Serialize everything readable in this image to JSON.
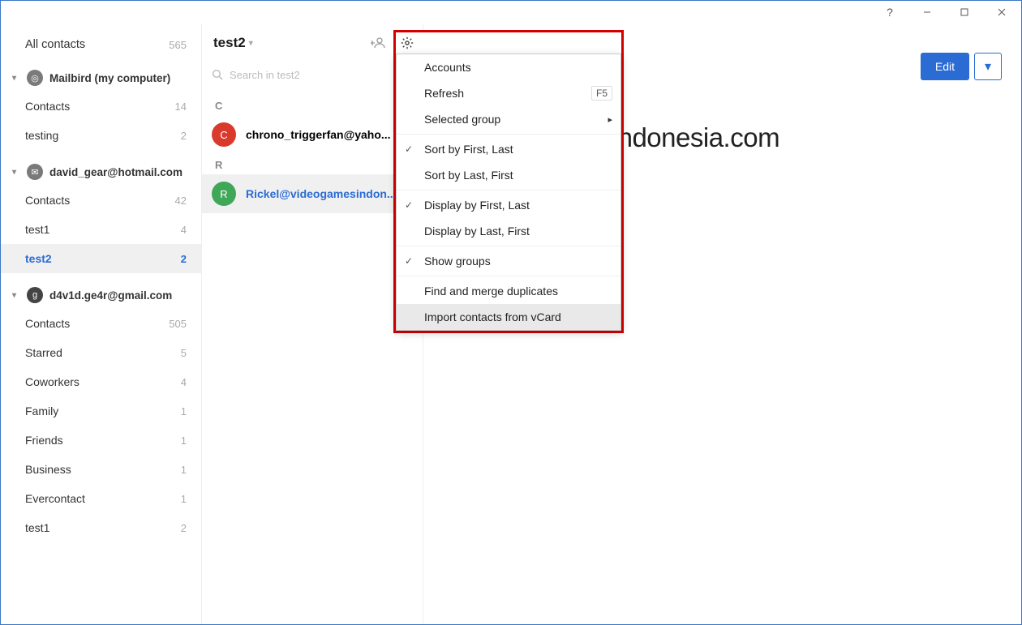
{
  "titlebar": {
    "help": "?",
    "min": "min",
    "max": "max",
    "close": "close"
  },
  "sidebar": {
    "all_label": "All contacts",
    "all_count": "565",
    "accounts": [
      {
        "name": "Mailbird (my computer)",
        "badge_bg": "#7a7a7a",
        "badge_fg": "#fff",
        "badge_type": "mailbird",
        "groups": [
          {
            "label": "Contacts",
            "count": "14",
            "selected": false
          },
          {
            "label": "testing",
            "count": "2",
            "selected": false
          }
        ]
      },
      {
        "name": "david_gear@hotmail.com",
        "badge_bg": "#7a7a7a",
        "badge_fg": "#fff",
        "badge_type": "outlook",
        "groups": [
          {
            "label": "Contacts",
            "count": "42",
            "selected": false
          },
          {
            "label": "test1",
            "count": "4",
            "selected": false
          },
          {
            "label": "test2",
            "count": "2",
            "selected": true
          }
        ]
      },
      {
        "name": "d4v1d.ge4r@gmail.com",
        "badge_bg": "#444",
        "badge_fg": "#fff",
        "badge_type": "google",
        "groups": [
          {
            "label": "Contacts",
            "count": "505",
            "selected": false
          },
          {
            "label": "Starred",
            "count": "5",
            "selected": false
          },
          {
            "label": "Coworkers",
            "count": "4",
            "selected": false
          },
          {
            "label": "Family",
            "count": "1",
            "selected": false
          },
          {
            "label": "Friends",
            "count": "1",
            "selected": false
          },
          {
            "label": "Business",
            "count": "1",
            "selected": false
          },
          {
            "label": "Evercontact",
            "count": "1",
            "selected": false
          },
          {
            "label": "test1",
            "count": "2",
            "selected": false
          }
        ]
      }
    ]
  },
  "middle": {
    "title": "test2",
    "search_placeholder": "Search in test2",
    "sections": [
      {
        "letter": "C",
        "rows": [
          {
            "name": "chrono_triggerfan@yaho...",
            "avatar": "C",
            "color": "#d93a2b",
            "selected": false
          }
        ]
      },
      {
        "letter": "R",
        "rows": [
          {
            "name": "Rickel@videogamesindon...",
            "avatar": "R",
            "color": "#3fa757",
            "selected": true
          }
        ]
      }
    ]
  },
  "menu": {
    "items": [
      {
        "label": "Accounts",
        "type": "plain"
      },
      {
        "label": "Refresh",
        "type": "plain",
        "shortcut": "F5"
      },
      {
        "label": "Selected group",
        "type": "submenu"
      },
      {
        "sep": true
      },
      {
        "label": "Sort by First, Last",
        "type": "check",
        "checked": true
      },
      {
        "label": "Sort by Last, First",
        "type": "check",
        "checked": false
      },
      {
        "sep": true
      },
      {
        "label": "Display by First, Last",
        "type": "check",
        "checked": true
      },
      {
        "label": "Display by Last, First",
        "type": "check",
        "checked": false
      },
      {
        "sep": true
      },
      {
        "label": "Show groups",
        "type": "check",
        "checked": true
      },
      {
        "sep": true
      },
      {
        "label": "Find and merge duplicates",
        "type": "plain"
      },
      {
        "label": "Import contacts from vCard",
        "type": "plain",
        "hover": true
      }
    ]
  },
  "detail": {
    "edit_label": "Edit",
    "big_name_visible": "l@videogamesindonesia.com",
    "email_visible": "ia.com"
  }
}
